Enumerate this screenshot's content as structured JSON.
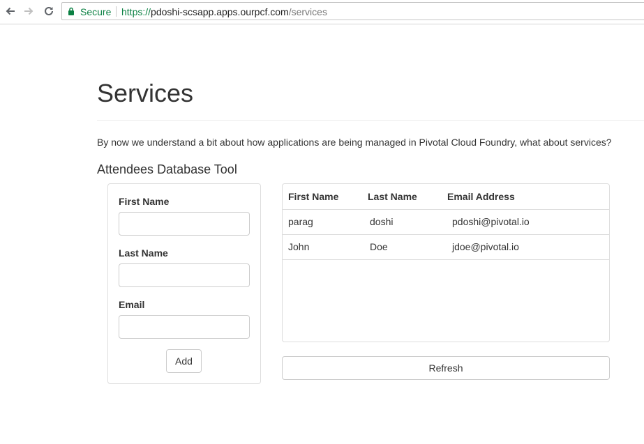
{
  "browser": {
    "secure_label": "Secure",
    "url_scheme": "https://",
    "url_host": "pdoshi-scsapp.apps.ourpcf.com",
    "url_path": "/services"
  },
  "page": {
    "title": "Services",
    "intro": "By now we understand a bit about how applications are being managed in Pivotal Cloud Foundry, what about services?",
    "tool_title": "Attendees Database Tool"
  },
  "form": {
    "first_name_label": "First Name",
    "first_name_value": "",
    "last_name_label": "Last Name",
    "last_name_value": "",
    "email_label": "Email",
    "email_value": "",
    "add_label": "Add"
  },
  "table": {
    "headers": [
      "First Name",
      "Last Name",
      "Email Address"
    ],
    "rows": [
      [
        "parag",
        "doshi",
        "pdoshi@pivotal.io"
      ],
      [
        "John",
        "Doe",
        "jdoe@pivotal.io"
      ]
    ]
  },
  "refresh_label": "Refresh",
  "colors": {
    "secure_green": "#0b8043",
    "border": "#dddddd",
    "text": "#333333"
  }
}
